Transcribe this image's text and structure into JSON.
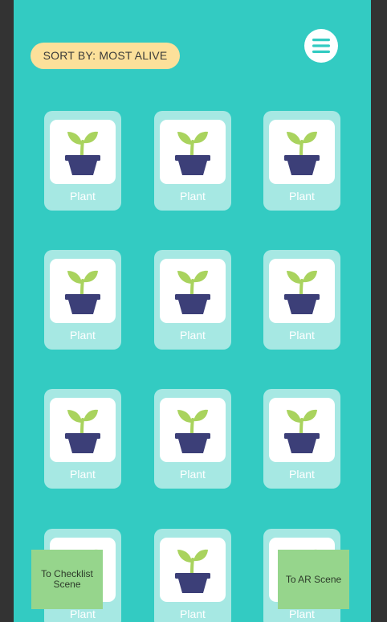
{
  "colors": {
    "background": "#33CBC2",
    "card": "#A6E8E3",
    "sort_pill": "#FCE09A",
    "scene_button": "#96D58C",
    "pot": "#3C3F78",
    "sprout": "#A9D35E"
  },
  "header": {
    "sort_label": "SORT BY: MOST ALIVE",
    "menu_icon": "hamburger-menu-icon"
  },
  "plants": [
    {
      "label": "Plant",
      "icon": "potted-sprout-icon"
    },
    {
      "label": "Plant",
      "icon": "potted-sprout-icon"
    },
    {
      "label": "Plant",
      "icon": "potted-sprout-icon"
    },
    {
      "label": "Plant",
      "icon": "potted-sprout-icon"
    },
    {
      "label": "Plant",
      "icon": "potted-sprout-icon"
    },
    {
      "label": "Plant",
      "icon": "potted-sprout-icon"
    },
    {
      "label": "Plant",
      "icon": "potted-sprout-icon"
    },
    {
      "label": "Plant",
      "icon": "potted-sprout-icon"
    },
    {
      "label": "Plant",
      "icon": "potted-sprout-icon"
    },
    {
      "label": "Plant",
      "icon": "potted-sprout-icon"
    },
    {
      "label": "Plant",
      "icon": "potted-sprout-icon"
    },
    {
      "label": "Plant",
      "icon": "potted-sprout-icon"
    }
  ],
  "footer": {
    "checklist_button": "To Checklist Scene",
    "ar_button": "To AR Scene"
  }
}
